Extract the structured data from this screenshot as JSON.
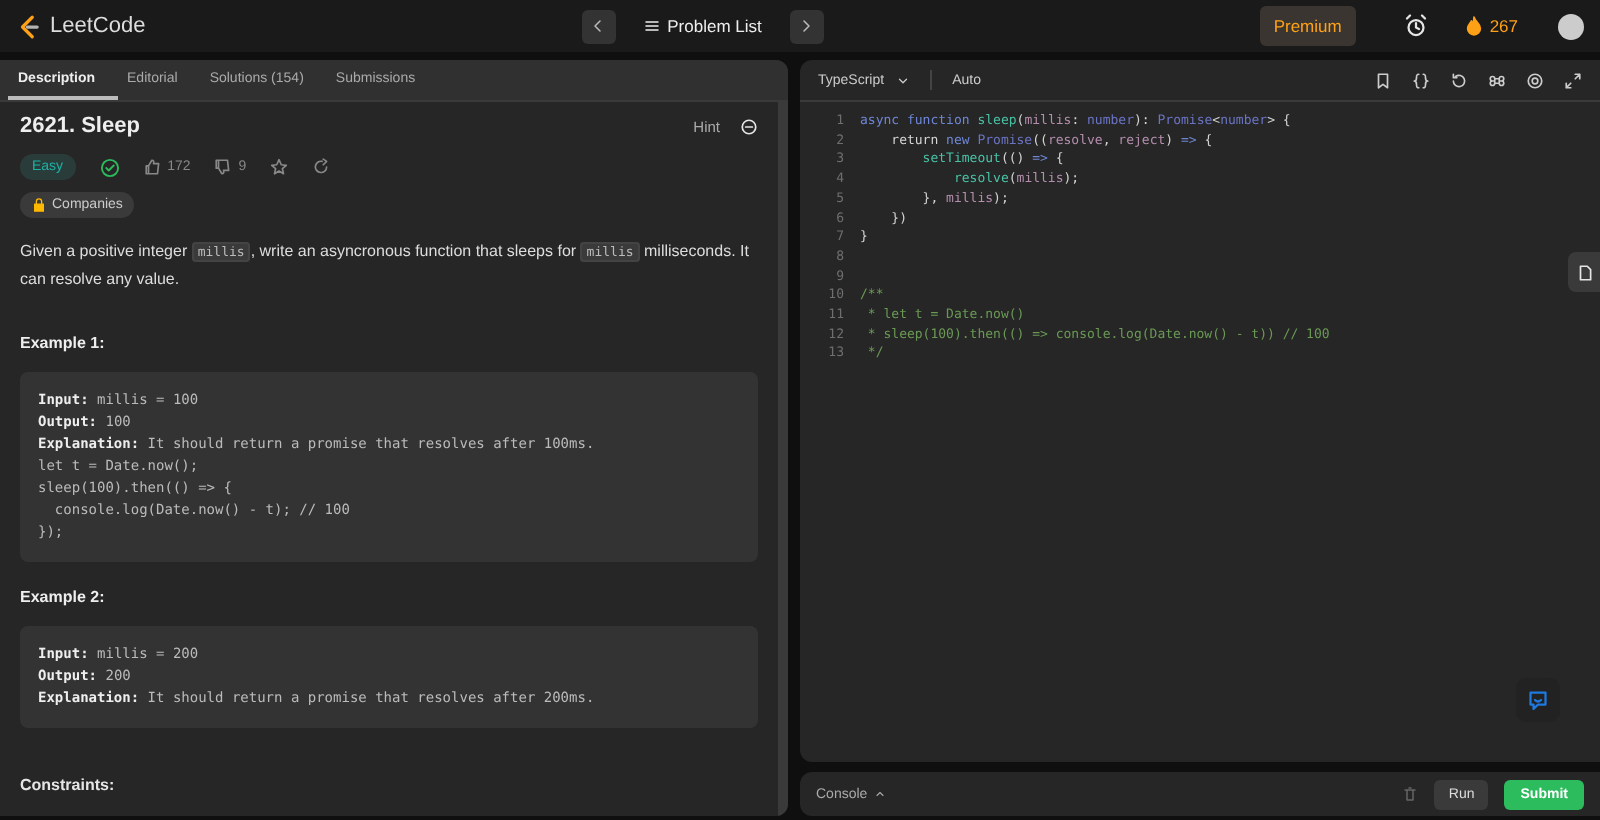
{
  "topbar": {
    "logo": "LeetCode",
    "problem_list": "Problem List",
    "premium": "Premium",
    "streak": "267"
  },
  "tabs": [
    {
      "label": "Description",
      "selected": true
    },
    {
      "label": "Editorial",
      "selected": false
    },
    {
      "label": "Solutions (154)",
      "selected": false
    },
    {
      "label": "Submissions",
      "selected": false
    }
  ],
  "problem": {
    "title": "2621. Sleep",
    "hint": "Hint",
    "difficulty": "Easy",
    "solved": true,
    "likes": "172",
    "dislikes": "9",
    "companies": "Companies",
    "description": [
      {
        "kind": "text",
        "text": "Given a positive integer "
      },
      {
        "kind": "code",
        "text": "millis"
      },
      {
        "kind": "text",
        "text": ", write an asyncronous function that sleeps for "
      },
      {
        "kind": "code",
        "text": "millis"
      },
      {
        "kind": "text",
        "text": " milliseconds. It can resolve any value."
      }
    ],
    "examples": [
      {
        "title": "Example 1:",
        "lines": [
          {
            "label": "Input:",
            "value": "millis = 100"
          },
          {
            "label": "Output:",
            "value": "100"
          },
          {
            "label": "Explanation:",
            "value": "It should return a promise that resolves after 100ms."
          },
          {
            "value": "let t = Date.now();"
          },
          {
            "value": "sleep(100).then(() => {"
          },
          {
            "value": "  console.log(Date.now() - t); // 100"
          },
          {
            "value": "});"
          }
        ]
      },
      {
        "title": "Example 2:",
        "lines": [
          {
            "label": "Input:",
            "value": "millis = 200"
          },
          {
            "label": "Output:",
            "value": "200"
          },
          {
            "label": "Explanation:",
            "value": "It should return a promise that resolves after 200ms."
          }
        ]
      }
    ],
    "constraints": "Constraints:"
  },
  "editor": {
    "language": "TypeScript",
    "mode": "Auto",
    "lines": [
      {
        "number": "1",
        "tokens": [
          {
            "kind": "keyword",
            "text": "async function "
          },
          {
            "kind": "function",
            "text": "sleep"
          },
          {
            "kind": "plain",
            "text": "("
          },
          {
            "kind": "param",
            "text": "millis"
          },
          {
            "kind": "plain",
            "text": ": "
          },
          {
            "kind": "type",
            "text": "number"
          },
          {
            "kind": "plain",
            "text": "): "
          },
          {
            "kind": "class",
            "text": "Promise"
          },
          {
            "kind": "plain",
            "text": "<"
          },
          {
            "kind": "type",
            "text": "number"
          },
          {
            "kind": "plain",
            "text": "> {"
          }
        ]
      },
      {
        "number": "2",
        "tokens": [
          {
            "kind": "plain",
            "text": "    return "
          },
          {
            "kind": "keyword",
            "text": "new "
          },
          {
            "kind": "class",
            "text": "Promise"
          },
          {
            "kind": "plain",
            "text": "(("
          },
          {
            "kind": "param",
            "text": "resolve"
          },
          {
            "kind": "plain",
            "text": ", "
          },
          {
            "kind": "param",
            "text": "reject"
          },
          {
            "kind": "plain",
            "text": ") "
          },
          {
            "kind": "keyword",
            "text": "=>"
          },
          {
            "kind": "plain",
            "text": " {"
          }
        ]
      },
      {
        "number": "3",
        "tokens": [
          {
            "kind": "function",
            "text": "        setTimeout"
          },
          {
            "kind": "plain",
            "text": "(() "
          },
          {
            "kind": "keyword",
            "text": "=>"
          },
          {
            "kind": "plain",
            "text": " {"
          }
        ]
      },
      {
        "number": "4",
        "tokens": [
          {
            "kind": "function",
            "text": "            resolve"
          },
          {
            "kind": "plain",
            "text": "("
          },
          {
            "kind": "param",
            "text": "millis"
          },
          {
            "kind": "plain",
            "text": ");"
          }
        ]
      },
      {
        "number": "5",
        "tokens": [
          {
            "kind": "plain",
            "text": "        }, "
          },
          {
            "kind": "param",
            "text": "millis"
          },
          {
            "kind": "plain",
            "text": ");"
          }
        ]
      },
      {
        "number": "6",
        "tokens": [
          {
            "kind": "plain",
            "text": "    })"
          }
        ]
      },
      {
        "number": "7",
        "tokens": [
          {
            "kind": "plain",
            "text": "}"
          }
        ]
      },
      {
        "number": "8"
      },
      {
        "number": "9"
      },
      {
        "number": "10",
        "tokens": [
          {
            "kind": "comment",
            "text": "/**"
          }
        ]
      },
      {
        "number": "11",
        "tokens": [
          {
            "kind": "comment",
            "text": " * let t = Date.now()"
          }
        ]
      },
      {
        "number": "12",
        "tokens": [
          {
            "kind": "comment",
            "text": " * sleep(100).then(() => console.log(Date.now() - t)) // 100"
          }
        ]
      },
      {
        "number": "13",
        "tokens": [
          {
            "kind": "comment",
            "text": " */"
          }
        ]
      }
    ]
  },
  "console": {
    "label": "Console",
    "run": "Run",
    "submit": "Submit"
  }
}
